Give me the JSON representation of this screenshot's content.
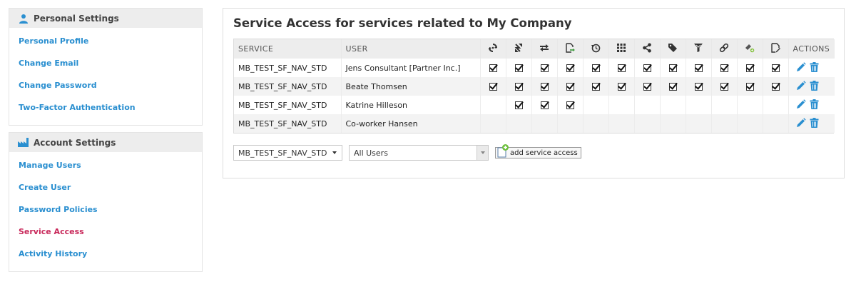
{
  "sidebar": {
    "personal": {
      "title": "Personal Settings",
      "icon": "user-icon",
      "items": [
        "Personal Profile",
        "Change Email",
        "Change Password",
        "Two-Factor Authentication"
      ]
    },
    "account": {
      "title": "Account Settings",
      "icon": "factory-icon",
      "items": [
        "Manage Users",
        "Create User",
        "Password Policies",
        "Service Access",
        "Activity History"
      ],
      "active": "Service Access"
    }
  },
  "main": {
    "title": "Service Access for services related to My Company",
    "columns": {
      "service": "SERVICE",
      "user": "USER",
      "actions": "ACTIONS",
      "permission_icons": [
        "sync-icon",
        "transfer-icon",
        "swap-icon",
        "export-icon",
        "history-icon",
        "grid-icon",
        "share-icon",
        "tag-icon",
        "filter-icon",
        "link-icon",
        "key-icon",
        "edit-icon"
      ]
    },
    "rows": [
      {
        "service": "MB_TEST_SF_NAV_STD",
        "user": "Jens Consultant [Partner Inc.]",
        "permissions": [
          true,
          true,
          true,
          true,
          true,
          true,
          true,
          true,
          true,
          true,
          true,
          true
        ]
      },
      {
        "service": "MB_TEST_SF_NAV_STD",
        "user": "Beate Thomsen",
        "permissions": [
          true,
          true,
          true,
          true,
          true,
          true,
          true,
          true,
          true,
          true,
          true,
          true
        ]
      },
      {
        "service": "MB_TEST_SF_NAV_STD",
        "user": "Katrine Hilleson",
        "permissions": [
          false,
          true,
          true,
          true,
          false,
          false,
          false,
          false,
          false,
          false,
          false,
          false
        ]
      },
      {
        "service": "MB_TEST_SF_NAV_STD",
        "user": "Co-worker Hansen",
        "permissions": [
          false,
          false,
          false,
          false,
          false,
          false,
          false,
          false,
          false,
          false,
          false,
          false
        ]
      }
    ],
    "controls": {
      "service_select": "MB_TEST_SF_NAV_STD",
      "user_select": "All Users",
      "add_button": "add service access"
    }
  },
  "colors": {
    "link": "#2a8fd0",
    "active_link": "#c8285a",
    "header_bg": "#ededed"
  }
}
